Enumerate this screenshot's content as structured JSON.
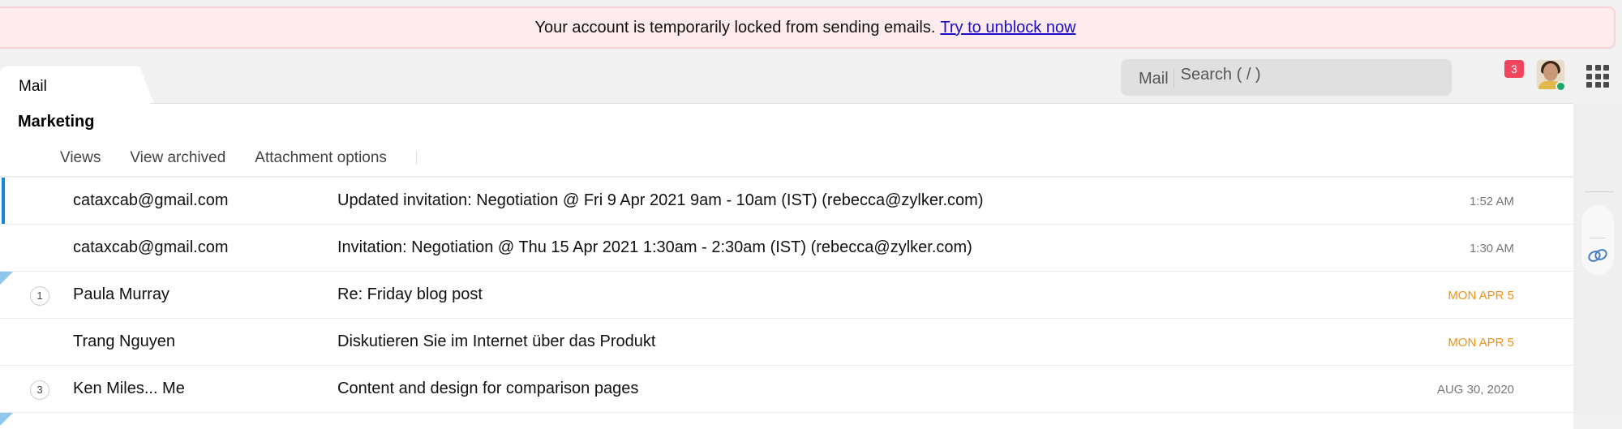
{
  "banner": {
    "message": "Your account is temporarily locked from sending emails.",
    "link_label": "Try to unblock now"
  },
  "header": {
    "active_tab": "Mail",
    "search": {
      "scope": "Mail",
      "placeholder": "Search ( / )",
      "value": ""
    },
    "notification_count": "3",
    "avatar_icon": "user-avatar",
    "presence_status": "online",
    "apps_icon": "grid-icon"
  },
  "folder": {
    "title": "Marketing"
  },
  "toolbar": {
    "items": [
      "Views",
      "View archived",
      "Attachment options"
    ]
  },
  "mails": [
    {
      "sender": "cataxcab@gmail.com",
      "subject": "Updated invitation: Negotiation @ Fri 9 Apr 2021 9am - 10am (IST) (rebecca@zylker.com)",
      "date": "1:52 AM",
      "thread_count": "",
      "selected": true,
      "flagged": false,
      "recent": false
    },
    {
      "sender": "cataxcab@gmail.com",
      "subject": "Invitation: Negotiation @ Thu 15 Apr 2021 1:30am - 2:30am (IST) (rebecca@zylker.com)",
      "date": "1:30 AM",
      "thread_count": "",
      "selected": false,
      "flagged": false,
      "recent": false
    },
    {
      "sender": "Paula Murray",
      "subject": "Re: Friday blog post",
      "date": "MON APR 5",
      "thread_count": "1",
      "selected": false,
      "flagged": true,
      "recent": true
    },
    {
      "sender": "Trang Nguyen",
      "subject": "Diskutieren Sie im Internet über das Produkt",
      "date": "MON APR 5",
      "thread_count": "",
      "selected": false,
      "flagged": false,
      "recent": true
    },
    {
      "sender": "Ken Miles... Me",
      "subject": "Content and design for comparison pages",
      "date": "AUG 30, 2020",
      "thread_count": "3",
      "selected": false,
      "flagged": false,
      "recent": false
    }
  ],
  "right_rail": {
    "icon": "zoho-link-icon"
  },
  "colors": {
    "banner_bg": "#fdebee",
    "link": "#1a0dcc",
    "badge": "#f2445c",
    "selected_accent": "#1688d8",
    "flag": "#8ec6ee",
    "recent_date": "#f0921a",
    "presence": "#1ea866"
  }
}
